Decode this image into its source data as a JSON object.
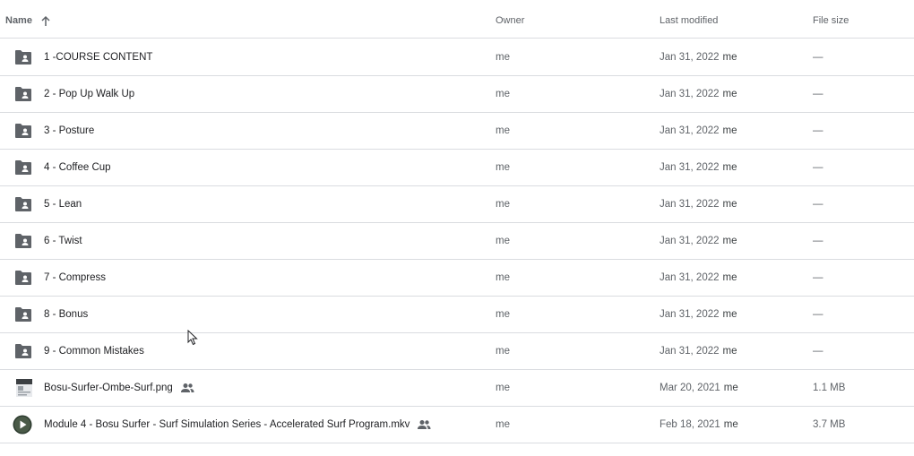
{
  "columns": {
    "name": "Name",
    "owner": "Owner",
    "last_modified": "Last modified",
    "file_size": "File size"
  },
  "sort_icon": "arrow-up-icon",
  "files": [
    {
      "name": "1 -COURSE CONTENT",
      "type": "shared-folder",
      "owner": "me",
      "modified": "Jan 31, 2022",
      "modified_by": "me",
      "size": "—"
    },
    {
      "name": "2 - Pop Up  Walk Up",
      "type": "shared-folder",
      "owner": "me",
      "modified": "Jan 31, 2022",
      "modified_by": "me",
      "size": "—"
    },
    {
      "name": "3 - Posture",
      "type": "shared-folder",
      "owner": "me",
      "modified": "Jan 31, 2022",
      "modified_by": "me",
      "size": "—"
    },
    {
      "name": "4 - Coffee Cup",
      "type": "shared-folder",
      "owner": "me",
      "modified": "Jan 31, 2022",
      "modified_by": "me",
      "size": "—"
    },
    {
      "name": "5 - Lean",
      "type": "shared-folder",
      "owner": "me",
      "modified": "Jan 31, 2022",
      "modified_by": "me",
      "size": "—"
    },
    {
      "name": "6 - Twist",
      "type": "shared-folder",
      "owner": "me",
      "modified": "Jan 31, 2022",
      "modified_by": "me",
      "size": "—"
    },
    {
      "name": "7 - Compress",
      "type": "shared-folder",
      "owner": "me",
      "modified": "Jan 31, 2022",
      "modified_by": "me",
      "size": "—"
    },
    {
      "name": "8 - Bonus",
      "type": "shared-folder",
      "owner": "me",
      "modified": "Jan 31, 2022",
      "modified_by": "me",
      "size": "—"
    },
    {
      "name": "9 - Common Mistakes",
      "type": "shared-folder",
      "owner": "me",
      "modified": "Jan 31, 2022",
      "modified_by": "me",
      "size": "—"
    },
    {
      "name": "Bosu-Surfer-Ombe-Surf.png",
      "type": "image",
      "shared": true,
      "owner": "me",
      "modified": "Mar 20, 2021",
      "modified_by": "me",
      "size": "1.1 MB"
    },
    {
      "name": "Module 4 - Bosu Surfer - Surf Simulation Series - Accelerated Surf Program.mkv",
      "type": "video",
      "shared": true,
      "owner": "me",
      "modified": "Feb 18, 2021",
      "modified_by": "me",
      "size": "3.7 MB"
    }
  ],
  "colors": {
    "text": "#202124",
    "muted": "#5f6368",
    "divider": "#dadce0",
    "folder_icon": "#5f6368"
  }
}
